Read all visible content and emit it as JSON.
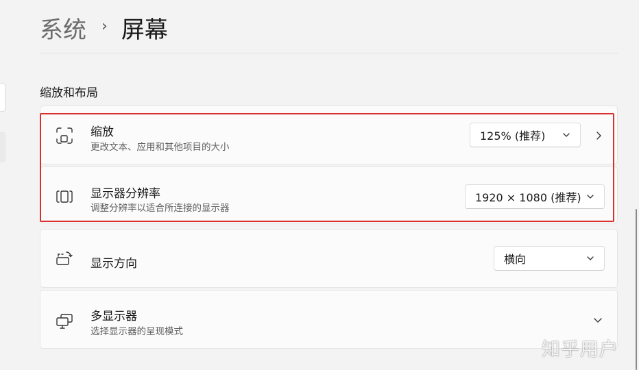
{
  "breadcrumb": {
    "parent": "系统",
    "separator": "›",
    "current": "屏幕"
  },
  "section": {
    "title": "缩放和布局"
  },
  "settings": [
    {
      "title": "缩放",
      "description": "更改文本、应用和其他项目的大小",
      "value": "125% (推荐)",
      "icon": "scale-icon"
    },
    {
      "title": "显示器分辨率",
      "description": "调整分辨率以适合所连接的显示器",
      "value": "1920 × 1080 (推荐)",
      "icon": "resolution-icon"
    },
    {
      "title": "显示方向",
      "description": "",
      "value": "横向",
      "icon": "orientation-icon"
    },
    {
      "title": "多显示器",
      "description": "选择显示器的呈现模式",
      "value": "",
      "icon": "multi-display-icon"
    }
  ],
  "annotation": {
    "color": "#d9302e"
  },
  "watermark": "知乎用户"
}
